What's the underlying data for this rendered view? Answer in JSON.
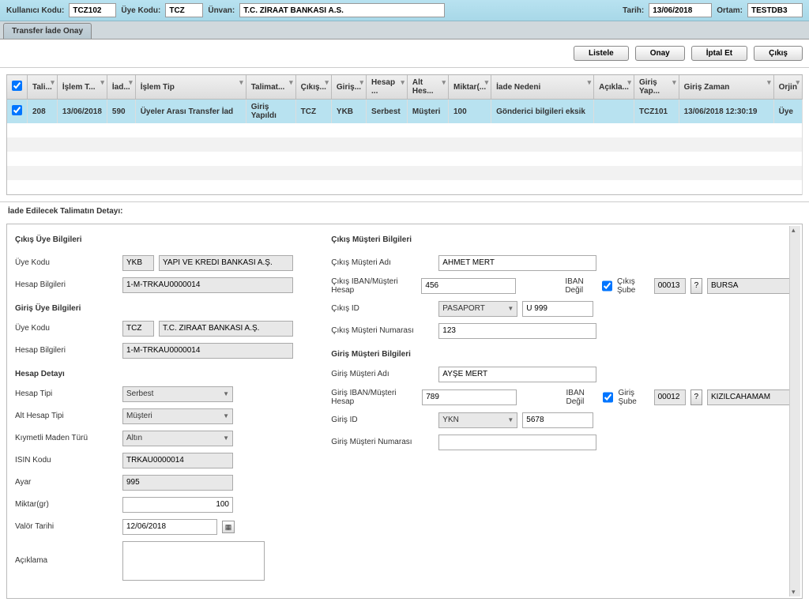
{
  "topbar": {
    "user_label": "Kullanıcı Kodu:",
    "user_code": "TCZ102",
    "member_label": "Üye Kodu:",
    "member_code": "TCZ",
    "title_label": "Ünvan:",
    "title_value": "T.C. ZİRAAT BANKASI A.S.",
    "date_label": "Tarih:",
    "date_value": "13/06/2018",
    "env_label": "Ortam:",
    "env_value": "TESTDB3"
  },
  "tab": {
    "label": "Transfer İade Onay"
  },
  "actions": {
    "list": "Listele",
    "approve": "Onay",
    "cancel": "İptal Et",
    "exit": "Çıkış"
  },
  "grid": {
    "cols": [
      "Tali...",
      "İşlem T...",
      "İad...",
      "İşlem Tip",
      "Talimat...",
      "Çıkış...",
      "Giriş...",
      "Hesap ...",
      "Alt Hes...",
      "Miktar(...",
      "İade Nedeni",
      "Açıkla...",
      "Giriş Yap...",
      "Giriş Zaman",
      "Orjin"
    ],
    "row": {
      "c0": "208",
      "c1": "13/06/2018",
      "c2": "590",
      "c3": "Üyeler Arası Transfer İad",
      "c4": "Giriş Yapıldı",
      "c5": "TCZ",
      "c6": "YKB",
      "c7": "Serbest",
      "c8": "Müşteri",
      "c9": "100",
      "c10": "Gönderici bilgileri eksik",
      "c11": "",
      "c12": "TCZ101",
      "c13": "13/06/2018 12:30:19",
      "c14": "Üye"
    }
  },
  "detail": {
    "section_title": "İade Edilecek Talimatın Detayı:",
    "out_member_h": "Çıkış Üye Bilgileri",
    "in_member_h": "Giriş Üye Bilgileri",
    "account_detail_h": "Hesap Detayı",
    "out_cust_h": "Çıkış Müşteri Bilgileri",
    "in_cust_h": "Giriş Müşteri Bilgileri",
    "labels": {
      "member_code": "Üye Kodu",
      "account_info": "Hesap Bilgileri",
      "account_type": "Hesap Tipi",
      "sub_account_type": "Alt Hesap Tipi",
      "metal_type": "Kıymetli Maden Türü",
      "isin": "ISIN Kodu",
      "ayar": "Ayar",
      "qty": "Miktar(gr)",
      "valor": "Valör Tarihi",
      "desc": "Açıklama",
      "cust_name_out": "Çıkış Müşteri Adı",
      "iban_out": "Çıkış IBAN/Müşteri Hesap",
      "id_out": "Çıkış ID",
      "cust_no_out": "Çıkış Müşteri Numarası",
      "cust_name_in": "Giriş Müşteri Adı",
      "iban_in": "Giriş IBAN/Müşteri Hesap",
      "id_in": "Giriş ID",
      "cust_no_in": "Giriş Müşteri Numarası",
      "iban_not": "IBAN Değil",
      "out_branch": "Çıkış Şube",
      "in_branch": "Giriş Şube"
    },
    "vals": {
      "out_code": "YKB",
      "out_name": "YAPI VE KREDİ BANKASI A.Ş.",
      "out_acct": "1-M-TRKAU0000014",
      "in_code": "TCZ",
      "in_name": "T.C. ZİRAAT BANKASI A.Ş.",
      "in_acct": "1-M-TRKAU0000014",
      "acct_type": "Serbest",
      "sub_type": "Müşteri",
      "metal": "Altın",
      "isin": "TRKAU0000014",
      "ayar": "995",
      "qty": "100",
      "valor": "12/06/2018",
      "out_cust_name": "AHMET MERT",
      "out_iban": "456",
      "out_branch_code": "00013",
      "out_branch_name": "BURSA",
      "out_id_type": "PASAPORT",
      "out_id_val": "U 999",
      "out_cust_no": "123",
      "in_cust_name": "AYŞE MERT",
      "in_iban": "789",
      "in_branch_code": "00012",
      "in_branch_name": "KIZILCAHAMAM",
      "in_id_type": "YKN",
      "in_id_val": "5678"
    }
  }
}
